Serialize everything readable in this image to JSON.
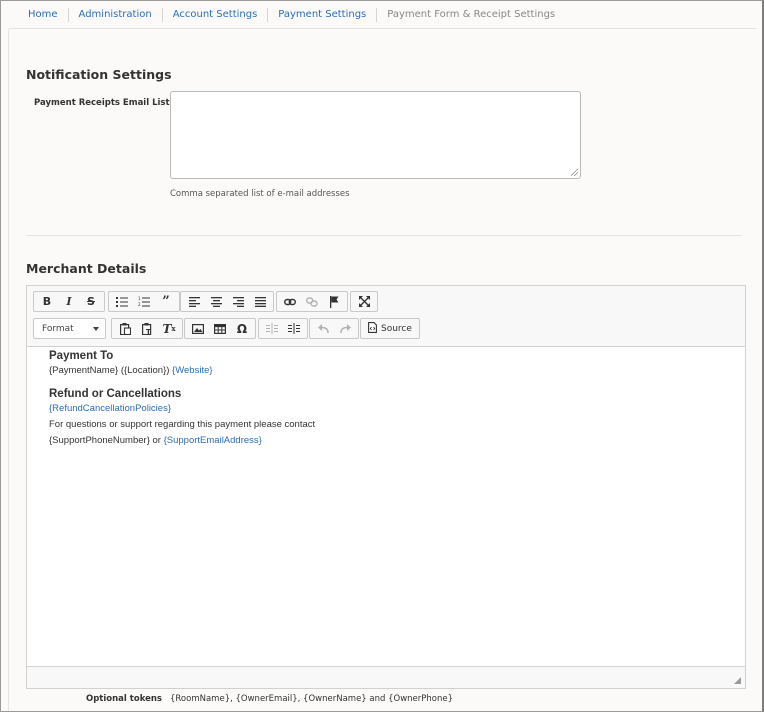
{
  "breadcrumb": {
    "items": [
      "Home",
      "Administration",
      "Account Settings",
      "Payment Settings"
    ],
    "current": "Payment Form & Receipt Settings"
  },
  "notification": {
    "title": "Notification Settings",
    "email_list_label": "Payment Receipts Email List",
    "email_list_value": "",
    "email_list_hint": "Comma separated list of e-mail addresses"
  },
  "merchant": {
    "title": "Merchant Details",
    "toolbar": {
      "row1": [
        [
          "bold-icon",
          "italic-icon",
          "strikethrough-icon"
        ],
        [
          "bulleted-list-icon",
          "numbered-list-icon",
          "blockquote-icon"
        ],
        [
          "align-left-icon",
          "align-center-icon",
          "align-right-icon",
          "justify-icon"
        ],
        [
          "link-icon",
          "unlink-icon",
          "anchor-flag-icon"
        ],
        [
          "maximize-icon"
        ]
      ],
      "format_label": "Format",
      "source_label": "Source"
    },
    "content": {
      "heading1": "Payment To",
      "line1_text": "{PaymentName} ({Location})",
      "line1_token": "{Website}",
      "heading2": "Refund or Cancellations",
      "line2_token": "{RefundCancellationPolicies}",
      "line3_text": "For questions or support regarding this payment please contact",
      "line4_text_a": "{SupportPhoneNumber} or",
      "line4_token": "{SupportEmailAddress}"
    }
  },
  "optional_tokens": {
    "label": "Optional tokens",
    "value": "{RoomName}, {OwnerEmail}, {OwnerName} and {OwnerPhone}"
  },
  "colors": {
    "link": "#2a6ebb",
    "background": "#fcfaf8",
    "border": "#d1d1d1"
  }
}
